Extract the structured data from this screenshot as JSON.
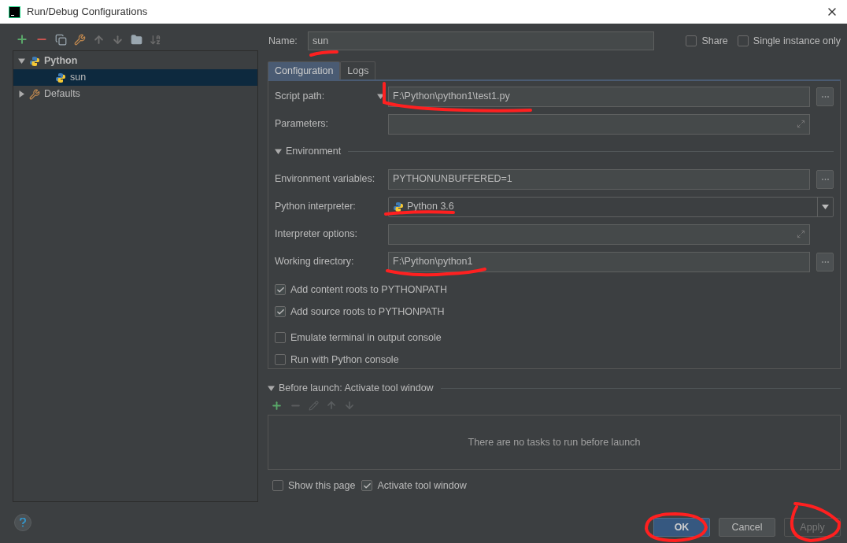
{
  "window": {
    "title": "Run/Debug Configurations"
  },
  "tree": [
    {
      "label": "Python",
      "kind": "python",
      "expanded": true,
      "selected": false,
      "children": [
        {
          "label": "sun",
          "kind": "python",
          "selected": true
        }
      ]
    },
    {
      "label": "Defaults",
      "kind": "defaults",
      "expanded": false,
      "selected": false
    }
  ],
  "name": {
    "label": "Name:",
    "value": "sun"
  },
  "top_options": [
    {
      "label": "Share",
      "checked": false
    },
    {
      "label": "Single instance only",
      "checked": false
    }
  ],
  "tabs": [
    {
      "label": "Configuration",
      "selected": true
    },
    {
      "label": "Logs",
      "selected": false
    }
  ],
  "fields_top": [
    {
      "label": "Script path:",
      "kind": "browse",
      "menu": true,
      "value": "F:\\Python\\python1\\test1.py"
    },
    {
      "label": "Parameters:",
      "kind": "expand"
    }
  ],
  "environment": {
    "title": "Environment",
    "expanded": true,
    "fields": [
      {
        "label": "Environment variables:",
        "kind": "browse",
        "value": "PYTHONUNBUFFERED=1"
      },
      {
        "label": "Python interpreter:",
        "kind": "select",
        "value": "Python 3.6"
      },
      {
        "label": "Interpreter options:",
        "kind": "expand"
      },
      {
        "label": "Working directory:",
        "kind": "browse",
        "value": "F:\\Python\\python1"
      }
    ]
  },
  "options": [
    {
      "label": "Add content roots to PYTHONPATH",
      "checked": true
    },
    {
      "label": "Add source roots to PYTHONPATH",
      "checked": true
    },
    {
      "label": "Emulate terminal in output console",
      "checked": false
    },
    {
      "label": "Run with Python console",
      "checked": false
    }
  ],
  "before_launch": {
    "title": "Before launch: Activate tool window",
    "expanded": true,
    "empty_text": "There are no tasks to run before launch"
  },
  "bottom_options": [
    {
      "label": "Show this page",
      "checked": false
    },
    {
      "label": "Activate tool window",
      "checked": true
    }
  ],
  "buttons": [
    {
      "label": "OK",
      "kind": "primary",
      "disabled": false
    },
    {
      "label": "Cancel",
      "kind": "normal",
      "disabled": false
    },
    {
      "label": "Apply",
      "kind": "normal",
      "disabled": true
    }
  ]
}
